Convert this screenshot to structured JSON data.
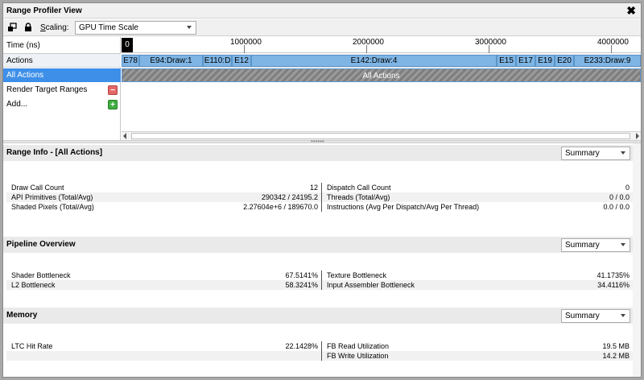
{
  "window": {
    "title": "Range Profiler View",
    "close_label": "✖"
  },
  "toolbar": {
    "scaling_label_prefix": "S",
    "scaling_label_rest": "caling:",
    "scaling_value": "GPU Time Scale"
  },
  "timeline": {
    "left_rows": {
      "time": "Time (ns)",
      "actions": "Actions",
      "all_actions": "All Actions",
      "render_target_ranges": "Render Target Ranges",
      "add": "Add..."
    },
    "ruler": {
      "zero": "0",
      "ticks": [
        "1000000",
        "2000000",
        "3000000",
        "4000000"
      ]
    },
    "actions": [
      "E78",
      "E94:Draw:1",
      "E110:D",
      "E12",
      "E142:Draw:4",
      "E15",
      "E17",
      "E19",
      "E20",
      "E233:Draw:9"
    ],
    "all_actions_bar": "All Actions"
  },
  "range_info": {
    "title": "Range Info - [All Actions]",
    "dropdown": "Summary",
    "left": [
      {
        "key": "Draw Call Count",
        "value": "12"
      },
      {
        "key": "API Primitives (Total/Avg)",
        "value": "290342 / 24195.2"
      },
      {
        "key": "Shaded Pixels (Total/Avg)",
        "value": "2.27604e+6 / 189670.0"
      }
    ],
    "right": [
      {
        "key": "Dispatch Call Count",
        "value": "0"
      },
      {
        "key": "Threads (Total/Avg)",
        "value": "0 / 0.0"
      },
      {
        "key": "Instructions (Avg Per Dispatch/Avg Per Thread)",
        "value": "0.0 / 0.0"
      }
    ]
  },
  "pipeline": {
    "title": "Pipeline Overview",
    "dropdown": "Summary",
    "left": [
      {
        "key": "Shader Bottleneck",
        "value": "67.5141%"
      },
      {
        "key": "L2 Bottleneck",
        "value": "58.3241%"
      }
    ],
    "right": [
      {
        "key": "Texture Bottleneck",
        "value": "41.1735%"
      },
      {
        "key": "Input Assembler Bottleneck",
        "value": "34.4116%"
      }
    ]
  },
  "memory": {
    "title": "Memory",
    "dropdown": "Summary",
    "left": [
      {
        "key": "LTC Hit Rate",
        "value": "22.1428%"
      },
      {
        "key": "",
        "value": ""
      }
    ],
    "right": [
      {
        "key": "FB Read Utilization",
        "value": "19.5 MB"
      },
      {
        "key": "FB Write Utilization",
        "value": "14.2 MB"
      }
    ]
  },
  "colors": {
    "selection": "#3d8fe8",
    "action_block": "#7fb5e4",
    "minus": "#e26868",
    "plus": "#3fae3f"
  }
}
